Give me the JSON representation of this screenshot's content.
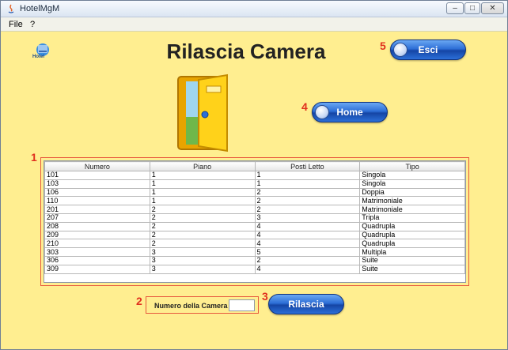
{
  "window": {
    "title": "HotelMgM",
    "controls": {
      "minimize": "–",
      "maximize": "□",
      "close": "✕"
    }
  },
  "menu": {
    "items": [
      "File",
      "?"
    ]
  },
  "header": {
    "logo_text": "Hotel",
    "title": "Rilascia Camera"
  },
  "annotations": [
    "1",
    "2",
    "3",
    "4",
    "5"
  ],
  "buttons": {
    "exit": {
      "label": "Esci",
      "icon": "back-arrow-icon"
    },
    "home": {
      "label": "Home",
      "icon": "home-icon"
    },
    "release": {
      "label": "Rilascia"
    }
  },
  "rooms_table": {
    "columns": [
      "Numero",
      "Piano",
      "Posti Letto",
      "Tipo"
    ],
    "rows": [
      [
        "101",
        "1",
        "1",
        "Singola"
      ],
      [
        "103",
        "1",
        "1",
        "Singola"
      ],
      [
        "106",
        "1",
        "2",
        "Doppia"
      ],
      [
        "110",
        "1",
        "2",
        "Matrimoniale"
      ],
      [
        "201",
        "2",
        "2",
        "Matrimoniale"
      ],
      [
        "207",
        "2",
        "3",
        "Tripla"
      ],
      [
        "208",
        "2",
        "4",
        "Quadrupla"
      ],
      [
        "209",
        "2",
        "4",
        "Quadrupla"
      ],
      [
        "210",
        "2",
        "4",
        "Quadrupla"
      ],
      [
        "303",
        "3",
        "5",
        "Multipla"
      ],
      [
        "306",
        "3",
        "2",
        "Suite"
      ],
      [
        "309",
        "3",
        "4",
        "Suite"
      ]
    ]
  },
  "room_field": {
    "label": "Numero della Camera",
    "value": ""
  },
  "colors": {
    "background": "#ffee90",
    "annotation": "#e0301e",
    "button": "#2d6ed6"
  }
}
